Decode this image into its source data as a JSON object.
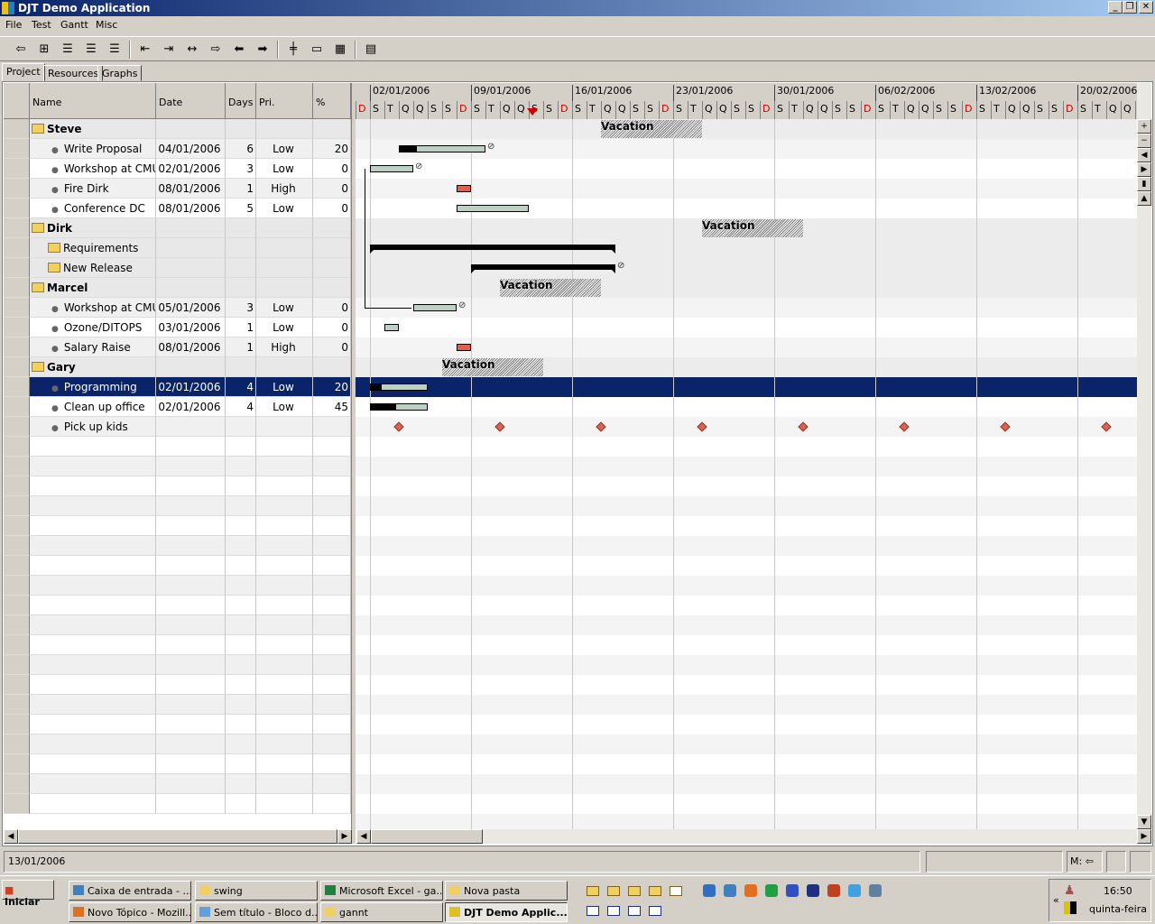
{
  "window": {
    "title": "DJT Demo Application",
    "controls": [
      "_",
      "❐",
      "✕"
    ]
  },
  "menu": [
    "File",
    "Test",
    "Gantt",
    "Misc"
  ],
  "toolbar": [
    {
      "icon": "back-arrow-icon",
      "glyph": "⇦"
    },
    {
      "icon": "expand-icon",
      "glyph": "⊞"
    },
    {
      "icon": "indent-icon",
      "glyph": "☰"
    },
    {
      "icon": "align-icon",
      "glyph": "☰"
    },
    {
      "icon": "collapse-icon",
      "glyph": "☰"
    },
    {
      "icon": "insert-before-icon",
      "glyph": "⇤"
    },
    {
      "icon": "insert-after-icon",
      "glyph": "⇥"
    },
    {
      "icon": "link-icon",
      "glyph": "↔"
    },
    {
      "icon": "milestone-icon",
      "glyph": "⇨"
    },
    {
      "icon": "left-arrow-icon",
      "glyph": "⬅"
    },
    {
      "icon": "right-arrow-icon",
      "glyph": "➡"
    },
    {
      "icon": "split-icon",
      "glyph": "╪"
    },
    {
      "icon": "note-icon",
      "glyph": "▭"
    },
    {
      "icon": "grid-icon",
      "glyph": "▦"
    },
    {
      "icon": "preview-icon",
      "glyph": "▤"
    }
  ],
  "tabs": [
    "Project",
    "Resources",
    "Graphs"
  ],
  "columns": [
    "Name",
    "Date",
    "Days",
    "Pri.",
    "%"
  ],
  "rows": [
    {
      "type": "group",
      "name": "Steve",
      "exp": "−"
    },
    {
      "type": "task",
      "name": "Write Proposal",
      "date": "04/01/2006",
      "days": "6",
      "pri": "Low",
      "pct": "20"
    },
    {
      "type": "task",
      "name": "Workshop at CMU",
      "date": "02/01/2006",
      "days": "3",
      "pri": "Low",
      "pct": "0"
    },
    {
      "type": "task",
      "name": "Fire Dirk",
      "date": "08/01/2006",
      "days": "1",
      "pri": "High",
      "pct": "0"
    },
    {
      "type": "task",
      "name": "Conference DC",
      "date": "08/01/2006",
      "days": "5",
      "pri": "Low",
      "pct": "0"
    },
    {
      "type": "group",
      "name": "Dirk",
      "exp": "−"
    },
    {
      "type": "sub",
      "name": "Requirements",
      "exp": "+"
    },
    {
      "type": "sub",
      "name": "New Release",
      "exp": "+"
    },
    {
      "type": "group",
      "name": "Marcel",
      "exp": "−"
    },
    {
      "type": "task",
      "name": "Workshop at CMU",
      "date": "05/01/2006",
      "days": "3",
      "pri": "Low",
      "pct": "0"
    },
    {
      "type": "task",
      "name": "Ozone/DITOPS",
      "date": "03/01/2006",
      "days": "1",
      "pri": "Low",
      "pct": "0"
    },
    {
      "type": "task",
      "name": "Salary Raise",
      "date": "08/01/2006",
      "days": "1",
      "pri": "High",
      "pct": "0"
    },
    {
      "type": "group",
      "name": "Gary",
      "exp": "−"
    },
    {
      "type": "task",
      "name": "Programming",
      "date": "02/01/2006",
      "days": "4",
      "pri": "Low",
      "pct": "20",
      "selected": true
    },
    {
      "type": "task",
      "name": "Clean up office",
      "date": "02/01/2006",
      "days": "4",
      "pri": "Low",
      "pct": "45"
    },
    {
      "type": "task",
      "name": "Pick up kids"
    }
  ],
  "gantt": {
    "weeks": [
      "02/01/2006",
      "09/01/2006",
      "16/01/2006",
      "23/01/2006",
      "30/01/2006",
      "06/02/2006",
      "13/02/2006",
      "20/02/2006"
    ],
    "day_letters": [
      "D",
      "S",
      "T",
      "Q",
      "Q",
      "S",
      "S"
    ],
    "today_day": 12,
    "vacation_label": "Vacation",
    "items": [
      {
        "row": 0,
        "kind": "vacation",
        "start": 17,
        "days": 7
      },
      {
        "row": 1,
        "kind": "bar",
        "start": 3,
        "days": 6,
        "pct": 20,
        "link": true
      },
      {
        "row": 2,
        "kind": "bar",
        "start": 1,
        "days": 3,
        "pct": 0,
        "link": true
      },
      {
        "row": 3,
        "kind": "red",
        "start": 7,
        "days": 1
      },
      {
        "row": 4,
        "kind": "bar",
        "start": 7,
        "days": 5,
        "pct": 0
      },
      {
        "row": 5,
        "kind": "vacation",
        "start": 24,
        "days": 7
      },
      {
        "row": 6,
        "kind": "summary",
        "start": 1,
        "days": 17
      },
      {
        "row": 7,
        "kind": "summary",
        "start": 8,
        "days": 10,
        "link": true
      },
      {
        "row": 8,
        "kind": "vacation",
        "start": 10,
        "days": 7
      },
      {
        "row": 9,
        "kind": "bar",
        "start": 4,
        "days": 3,
        "pct": 0,
        "link": true
      },
      {
        "row": 10,
        "kind": "bar",
        "start": 2,
        "days": 1,
        "pct": 0
      },
      {
        "row": 11,
        "kind": "red",
        "start": 7,
        "days": 1
      },
      {
        "row": 12,
        "kind": "vacation",
        "start": 6,
        "days": 7
      },
      {
        "row": 13,
        "kind": "bar",
        "start": 1,
        "days": 4,
        "pct": 20
      },
      {
        "row": 14,
        "kind": "bar",
        "start": 1,
        "days": 4,
        "pct": 45
      },
      {
        "row": 15,
        "kind": "milestones",
        "start": 3,
        "every": 7,
        "count": 8
      }
    ]
  },
  "status": {
    "date": "13/01/2006",
    "mode": "M:",
    "mode_icon": "⇦"
  },
  "taskbar": {
    "start": "Iniciar",
    "tasks": [
      "Caixa de entrada - ...",
      "swing",
      "Microsoft Excel - ga...",
      "Nova pasta",
      "Novo Tópico - Mozill...",
      "Sem título - Bloco d...",
      "gannt",
      "DJT Demo Applic..."
    ],
    "time": "16:50",
    "day": "quinta-feira",
    "expand": "«"
  },
  "colors": {
    "selected": "#0a246a",
    "red": "#e06050",
    "weekend": "#d00000"
  }
}
